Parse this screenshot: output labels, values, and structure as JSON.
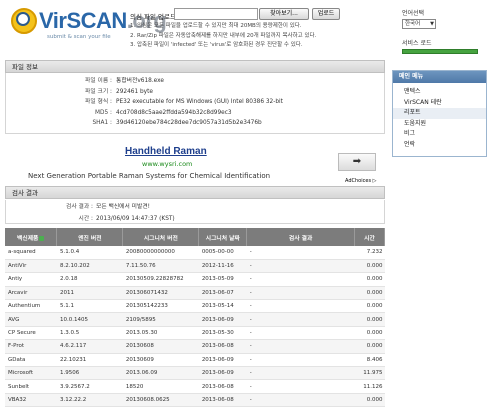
{
  "brand": {
    "name_main": "VirSCAN",
    "name_suffix": ".org",
    "tagline": "submit & scan your file"
  },
  "upload": {
    "label": "의심 파일 업로드",
    "browse_label": "찾아보기...",
    "submit_label": "업로드",
    "notes": [
      "1. 의심은 모든 파일을 업로드할 수 있지만 최대 20MB의 용량제한이 있다.",
      "2. Rar/Zip 파일은 자동압축해제를 하지만 내부에 20개 파일까지 목사하고 있다.",
      "3. 압축된 파일이 'infected' 또는 'virus'로 암호화된 경우 진단할 수 있다."
    ]
  },
  "language": {
    "title": "언어선택",
    "selected": "한국어"
  },
  "service": {
    "title": "서비스 로드",
    "level": 1.0
  },
  "file_info": {
    "title": "파일 정보",
    "rows": [
      {
        "k": "파일 이름 :",
        "v": "통합버전v618.exe"
      },
      {
        "k": "파일 크기 :",
        "v": "292461 byte"
      },
      {
        "k": "파일 형식 :",
        "v": "PE32 executable for MS Windows (GUI) Intel 80386 32-bit"
      },
      {
        "k": "MD5 :",
        "v": "4cd708d8c5aae2ffdda594b32c8d99ec3"
      },
      {
        "k": "SHA1 :",
        "v": "39d46120ebe784c28dee7dc9057a31d5b2e3476b"
      }
    ]
  },
  "ad": {
    "title": "Handheld Raman",
    "url": "www.wysri.com",
    "description": "Next Generation Portable Raman Systems for Chemical Identification",
    "arrow": "➡",
    "choices": "AdChoices ▷"
  },
  "result": {
    "title": "검사 결과",
    "meta": [
      {
        "k": "검사 결과 :",
        "v": "모든 백신에서 미발견!"
      },
      {
        "k": "시간 :",
        "v": "2013/06/09 14:47:37 (KST)"
      }
    ],
    "headers": [
      "백신제품",
      "엔진 버전",
      "시그니처 버전",
      "시그니처 날짜",
      "검사 결과",
      "시간"
    ],
    "rows": [
      [
        "a-squared",
        "5.1.0.4",
        "20080000000000",
        "0005-00-00",
        "-",
        "7.232"
      ],
      [
        "AntiVir",
        "8.2.10.202",
        "7.11.50.76",
        "2012-11-16",
        "-",
        "0.000"
      ],
      [
        "Antiy",
        "2.0.18",
        "20130509.22828782",
        "2013-05-09",
        "-",
        "0.000"
      ],
      [
        "Arcavir",
        "2011",
        "201306071432",
        "2013-06-07",
        "-",
        "0.000"
      ],
      [
        "Authentium",
        "5.1.1",
        "201305142233",
        "2013-05-14",
        "-",
        "0.000"
      ],
      [
        "AVG",
        "10.0.1405",
        "2109/5895",
        "2013-06-09",
        "-",
        "0.000"
      ],
      [
        "CP Secure",
        "1.3.0.5",
        "2013.05.30",
        "2013-05-30",
        "-",
        "0.000"
      ],
      [
        "F-Prot",
        "4.6.2.117",
        "20130608",
        "2013-06-08",
        "-",
        "0.000"
      ],
      [
        "GData",
        "22.10231",
        "20130609",
        "2013-06-09",
        "-",
        "8.406"
      ],
      [
        "Microsoft",
        "1.9506",
        "2013.06.09",
        "2013-06-09",
        "-",
        "11.975"
      ],
      [
        "Sunbelt",
        "3.9.2567.2",
        "18520",
        "2013-06-08",
        "-",
        "11.126"
      ],
      [
        "VBA32",
        "3.12.22.2",
        "20130608.0625",
        "2013-06-08",
        "-",
        "0.000"
      ]
    ]
  },
  "menu": {
    "title": "메인 메뉴",
    "items": [
      "맨텍스",
      "VirSCAN 테란",
      "리포트",
      "도움지원",
      "비그",
      "언락"
    ],
    "active_index": 2
  }
}
